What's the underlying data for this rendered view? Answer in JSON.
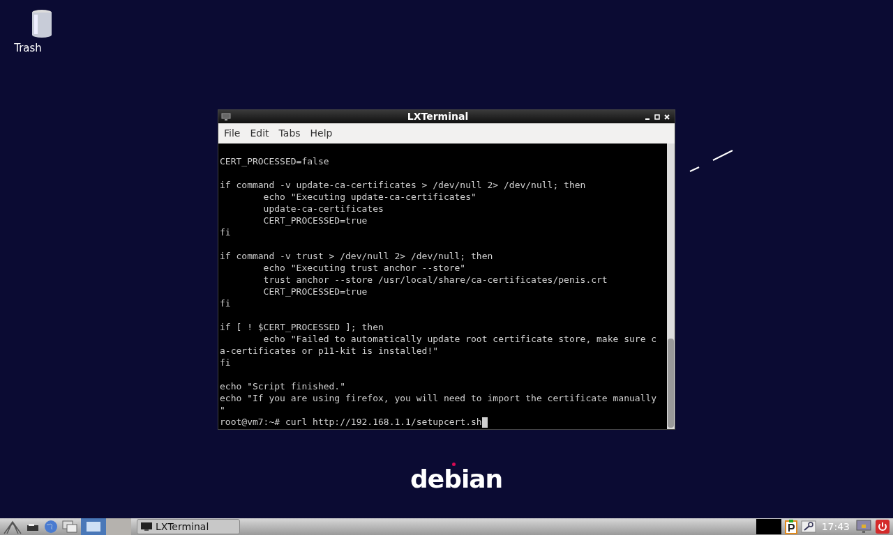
{
  "desktop": {
    "icons": [
      {
        "label": "Trash"
      }
    ],
    "logo": {
      "text": "debian"
    }
  },
  "window": {
    "title": "LXTerminal",
    "menu": [
      "File",
      "Edit",
      "Tabs",
      "Help"
    ],
    "terminal": {
      "blocks": [
        [
          "CERT_PROCESSED=false"
        ],
        [
          "if command -v update-ca-certificates > /dev/null 2> /dev/null; then",
          "        echo \"Executing update-ca-certificates\"",
          "        update-ca-certificates",
          "        CERT_PROCESSED=true",
          "fi"
        ],
        [
          "if command -v trust > /dev/null 2> /dev/null; then",
          "        echo \"Executing trust anchor --store\"",
          "        trust anchor --store /usr/local/share/ca-certificates/penis.crt",
          "        CERT_PROCESSED=true",
          "fi"
        ],
        [
          "if [ ! $CERT_PROCESSED ]; then",
          "        echo \"Failed to automatically update root certificate store, make sure c",
          "a-certificates or p11-kit is installed!\"",
          "fi"
        ],
        [
          "echo \"Script finished.\"",
          "echo \"If you are using firefox, you will need to import the certificate manually",
          "\""
        ]
      ],
      "prompt": "root@vm7:~# curl http://192.168.1.1/setupcert.sh",
      "cursor_visible": true
    }
  },
  "taskbar": {
    "workspaces": [
      {
        "selected": true
      },
      {
        "selected": false
      }
    ],
    "tasks": [
      {
        "label": "LXTerminal"
      }
    ],
    "clock": "17:43"
  }
}
